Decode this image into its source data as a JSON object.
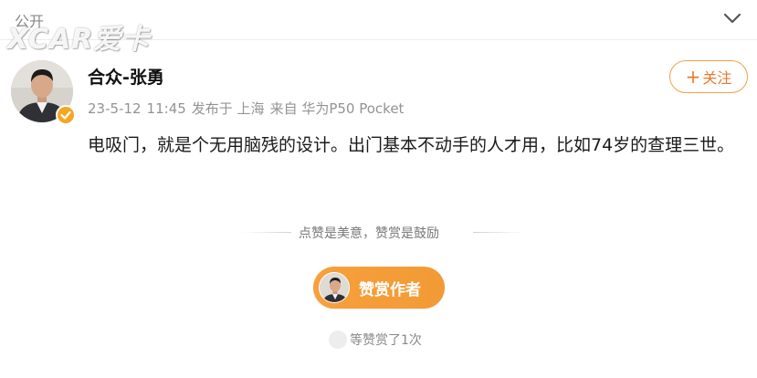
{
  "header": {
    "visibility_label": "公开",
    "watermark_text": "XCAR爱卡",
    "collapse_icon": "chevron-down-icon"
  },
  "post": {
    "author_name": "合众-张勇",
    "date": "23-5-12",
    "time": "11:45",
    "location": "发布于 上海",
    "source": "来自 华为P50 Pocket",
    "verified_badge_color": "#f5a623",
    "content": "电吸门，就是个无用脑残的设计。出门基本不动手的人才用，比如74岁的查理三世。"
  },
  "follow_button": {
    "label": "关注",
    "icon": "plus-icon",
    "color": "#e8792c"
  },
  "tip_section": {
    "tagline": "点赞是美意，赞赏是鼓励",
    "button_label": "赞赏作者",
    "button_color": "#f5a033",
    "count_text": "等赞赏了1次"
  }
}
